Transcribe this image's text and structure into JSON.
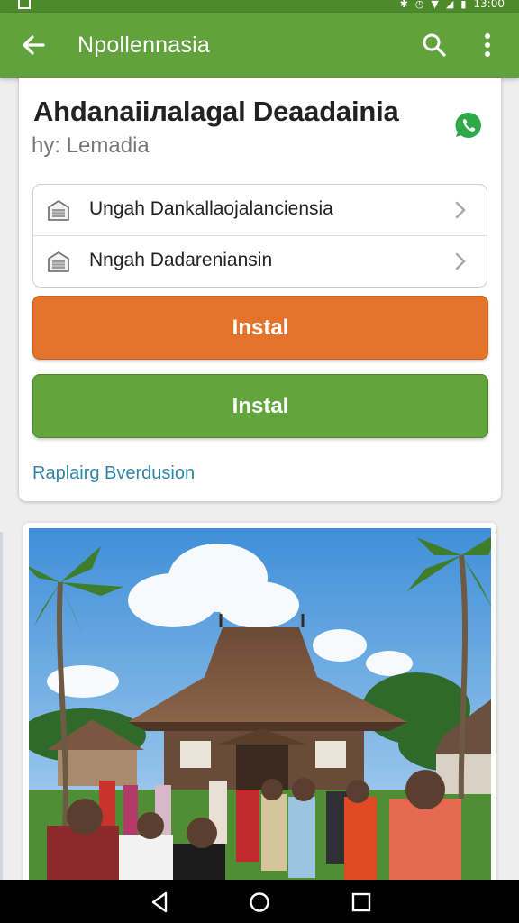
{
  "status_bar": {
    "time": "13:00"
  },
  "app_bar": {
    "title": "Npollennasia"
  },
  "app": {
    "name": "Ahdanaiiлalagal Deaadainia",
    "developer": "hy: Lemadia"
  },
  "list": [
    {
      "label": "Ungah Dankallaojalanciensia"
    },
    {
      "label": "Nngah Dadareniansin"
    }
  ],
  "buttons": {
    "install_primary": "Instal",
    "install_secondary": "Instal"
  },
  "link": "Raplairg Bverdusion",
  "colors": {
    "app_bar": "#62a23c",
    "orange_button": "#e4742c",
    "green_button": "#61a53c",
    "link": "#2f86a6"
  }
}
